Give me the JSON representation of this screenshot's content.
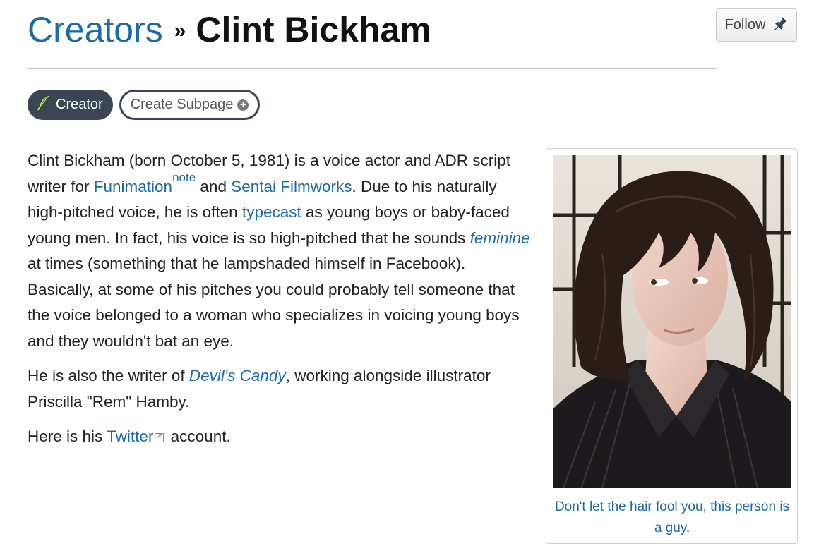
{
  "breadcrumb": {
    "parent": "Creators",
    "separator": "»",
    "current": "Clint Bickham"
  },
  "follow": {
    "label": "Follow"
  },
  "pills": {
    "creator": "Creator",
    "create_subpage": "Create Subpage"
  },
  "article": {
    "p1": {
      "t1": "Clint Bickham (born October 5, 1981) is a voice actor and ADR script writer for ",
      "link_funimation": "Funimation",
      "note": "note",
      "t2": " and ",
      "link_sentai": "Sentai Filmworks",
      "t3": ". Due to his naturally high-pitched voice, he is often ",
      "link_typecast": "typecast",
      "t4": " as young boys or baby-faced young men. In fact, his voice is so high-pitched that he sounds ",
      "link_feminine": "feminine",
      "t5": " at times (something that he lampshaded himself in Facebook). Basically, at some of his pitches you could probably tell someone that the voice belonged to a woman who specializes in voicing young boys and they wouldn't bat an eye."
    },
    "p2": {
      "t1": "He is also the writer of ",
      "link_devils_candy": "Devil's Candy",
      "t2": ", working alongside illustrator Priscilla \"Rem\" Hamby."
    },
    "p3": {
      "t1": "Here is his ",
      "link_twitter": "Twitter",
      "t2": " account."
    }
  },
  "infobox": {
    "caption_link": "Don't let the hair fool you, this person is a guy",
    "caption_end": "."
  },
  "icons": {
    "follow": "pushpin-icon",
    "creator": "feather-quill-icon",
    "subpage": "plus-circle-icon",
    "external": "external-link-icon"
  },
  "colors": {
    "link": "#1c6ba8",
    "pill_dark": "#3b4654"
  }
}
